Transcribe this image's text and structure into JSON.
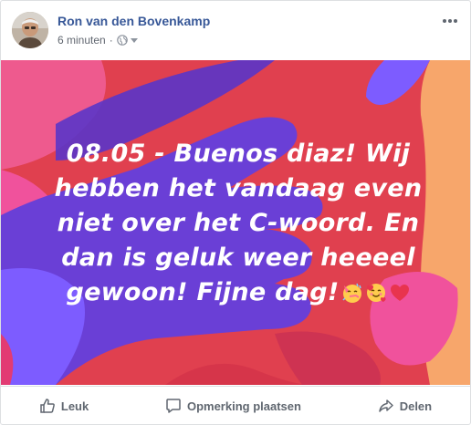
{
  "post": {
    "author": "Ron van den Bovenkamp",
    "timestamp": "6 minuten",
    "separator": "·",
    "audience_icon": "globe-icon",
    "text": "08.05 - Buenos diaz! Wij hebben het vandaag even niet over het C-woord. En dan is geluk weer heeeel gewoon! Fijne dag!",
    "emojis": [
      "partying-face",
      "smiling-face-with-hearts",
      "red-heart"
    ]
  },
  "actions": {
    "like_label": "Leuk",
    "comment_label": "Opmerking plaatsen",
    "share_label": "Delen"
  },
  "colors": {
    "link": "#385898",
    "background_red": "#e0404f",
    "shape_purple": "#6a3fd6",
    "shape_pink": "#f0529c",
    "shape_peach": "#f7a66b"
  }
}
